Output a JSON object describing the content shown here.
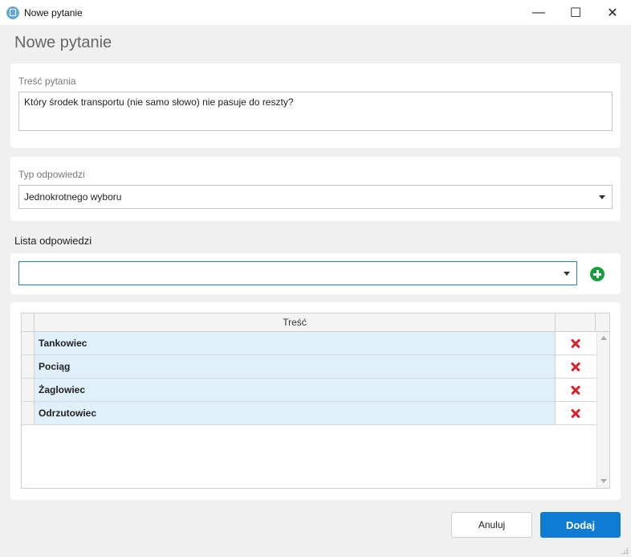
{
  "window": {
    "title": "Nowe pytanie",
    "controls": {
      "minimize": "—",
      "maximize": "☐",
      "close": "✕"
    }
  },
  "page": {
    "title": "Nowe pytanie"
  },
  "question": {
    "label": "Treść pytania",
    "value": "Który środek transportu (nie samo słowo) nie pasuje do reszty?"
  },
  "answer_type": {
    "label": "Typ odpowiedzi",
    "value": "Jednokrotnego wyboru"
  },
  "answers": {
    "section_title": "Lista odpowiedzi",
    "new_answer_value": "",
    "column_header": "Treść",
    "rows": [
      {
        "text": "Tankowiec"
      },
      {
        "text": "Pociąg"
      },
      {
        "text": "Żaglowiec"
      },
      {
        "text": "Odrzutowiec"
      }
    ]
  },
  "buttons": {
    "cancel": "Anuluj",
    "add": "Dodaj"
  },
  "colors": {
    "accent": "#0f7bd2",
    "row_highlight": "#dff0fb",
    "add_icon": "#149e3c",
    "delete_icon": "#d8232a"
  }
}
